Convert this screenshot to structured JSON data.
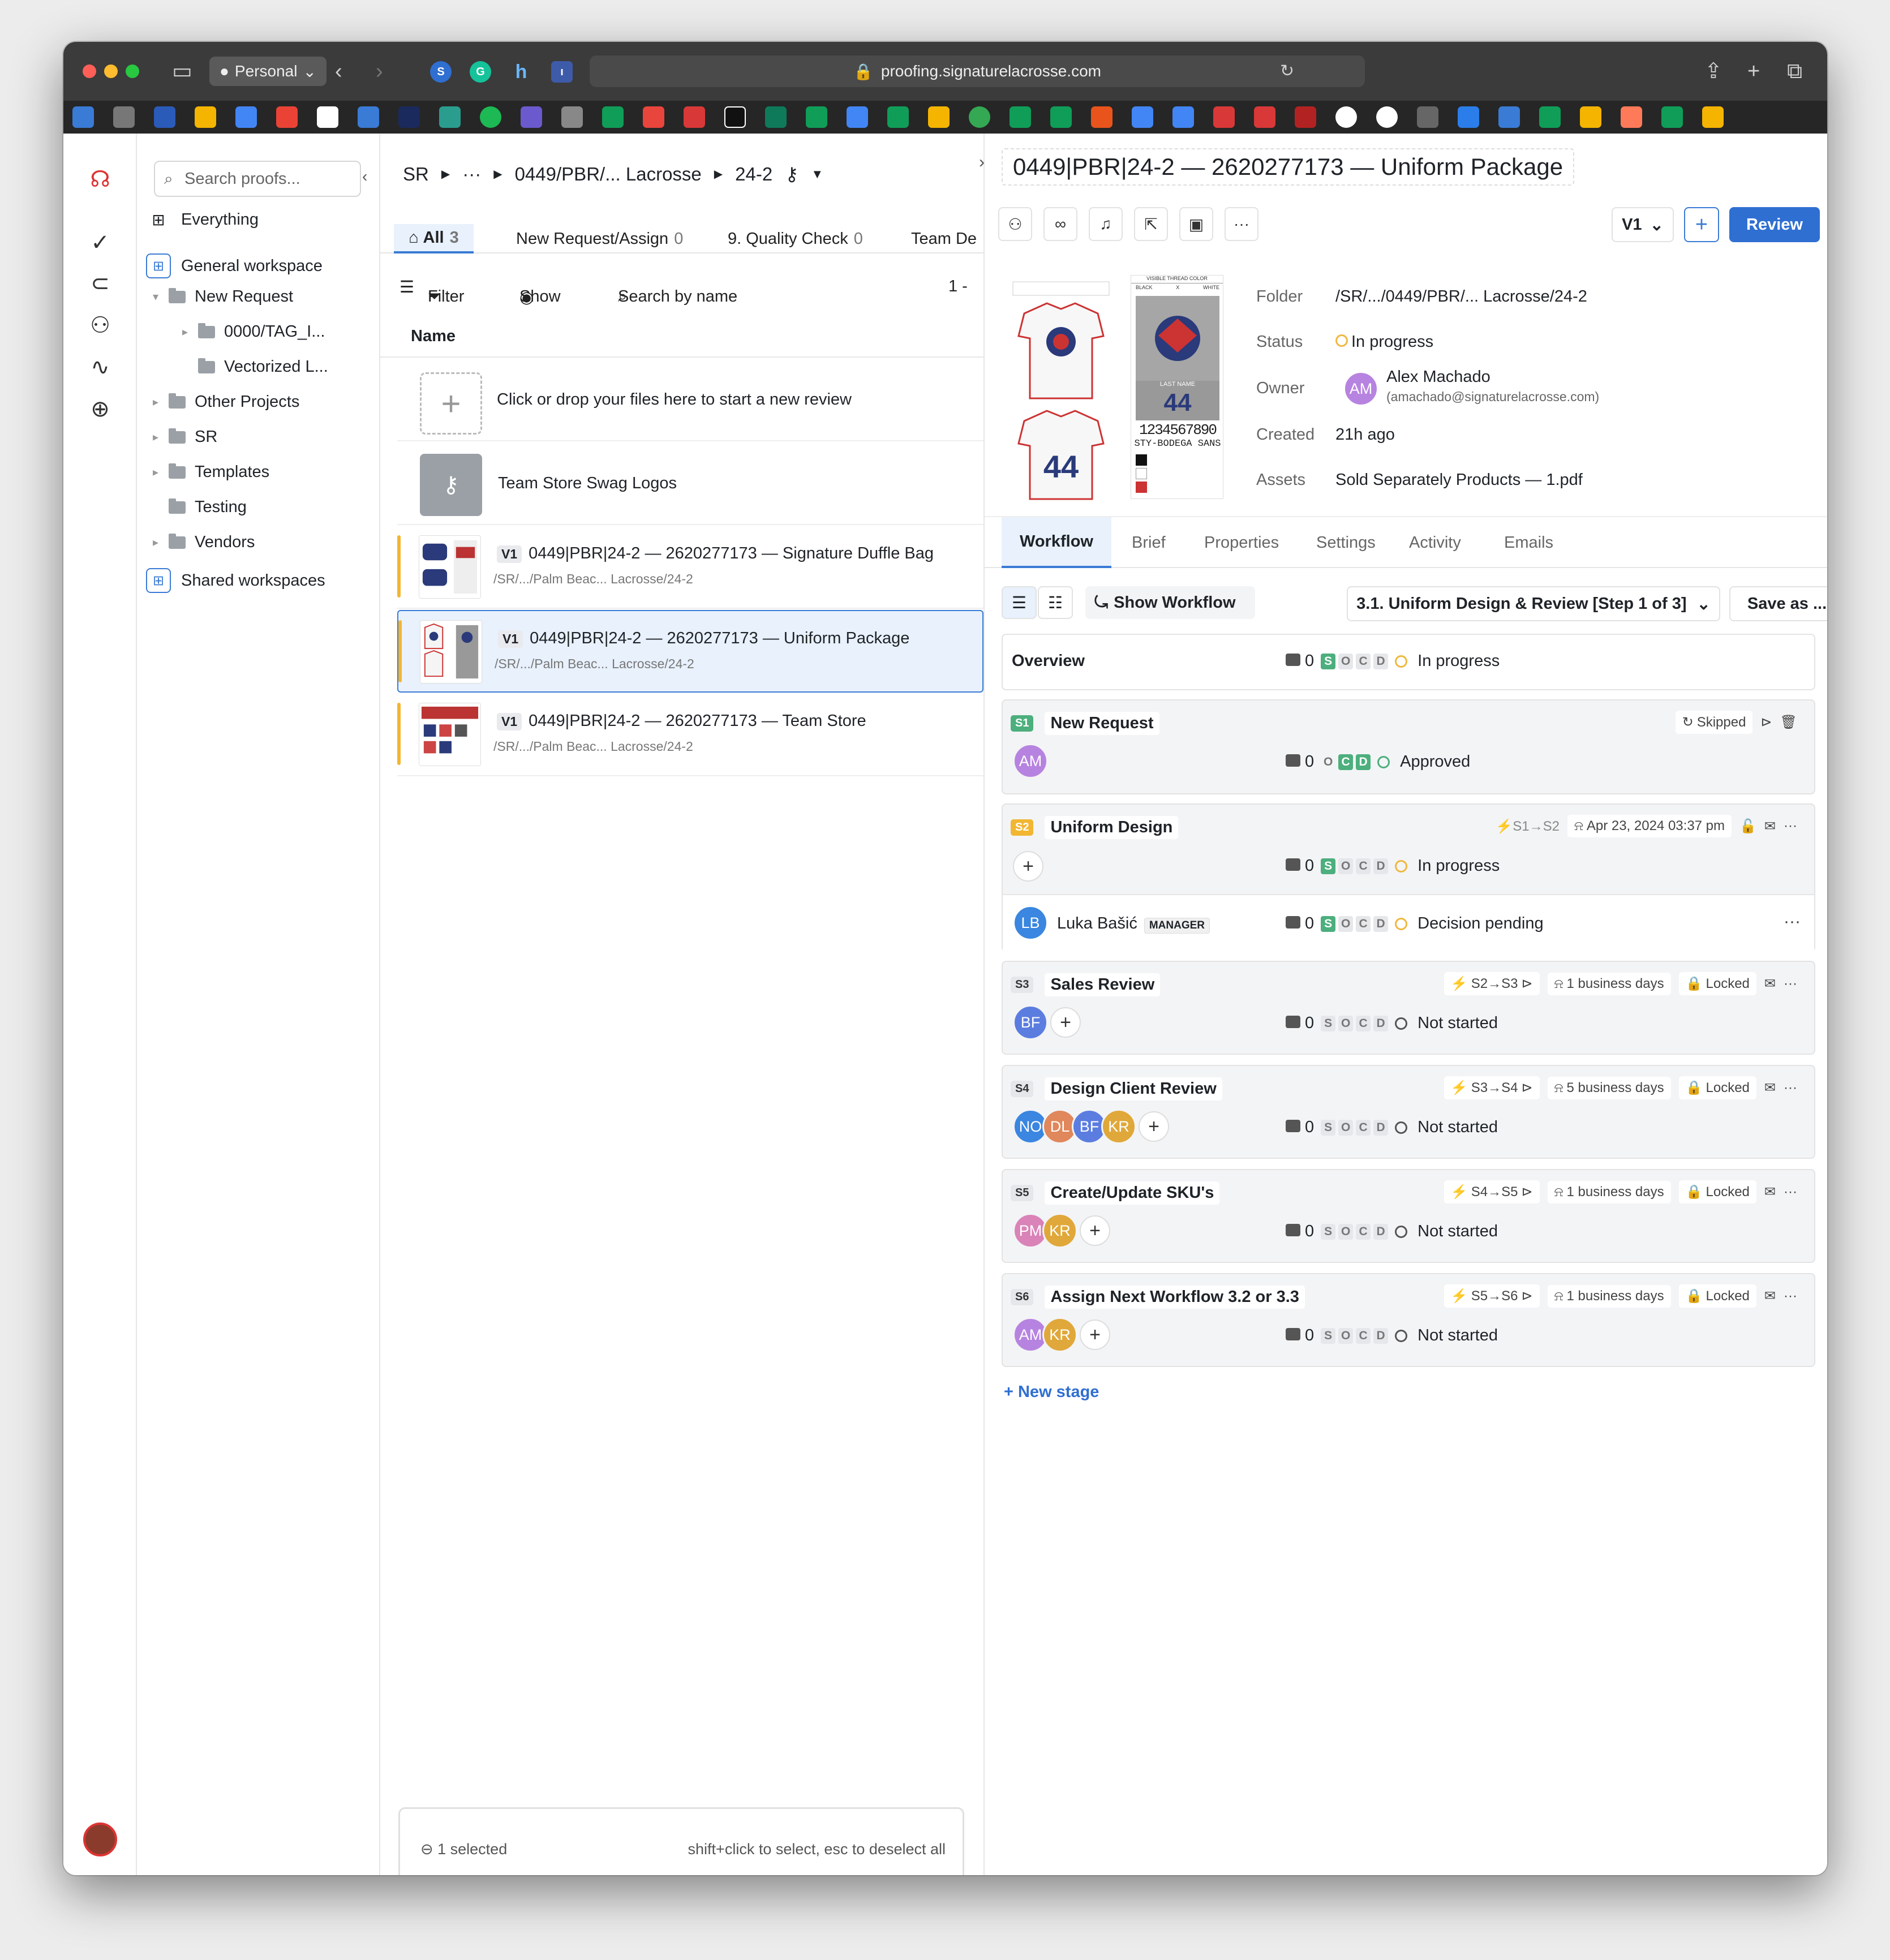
{
  "browser": {
    "profile": "Personal",
    "url": "proofing.signaturelacrosse.com"
  },
  "sidebar": {
    "search_placeholder": "Search proofs...",
    "everything": "Everything",
    "general_workspace": "General workspace",
    "tree": [
      "New Request",
      "0000/TAG_I...",
      "Vectorized L...",
      "Other Projects",
      "SR",
      "Templates",
      "Testing",
      "Vendors"
    ],
    "shared_workspaces": "Shared workspaces"
  },
  "list": {
    "breadcrumb": [
      "SR",
      "···",
      "0449/PBR/... Lacrosse",
      "24-2"
    ],
    "tabs": [
      {
        "label": "All",
        "count": "3"
      },
      {
        "label": "New Request/Assign",
        "count": "0"
      },
      {
        "label": "9. Quality Check",
        "count": "0"
      },
      {
        "label": "Team De",
        "count": ""
      }
    ],
    "toolbar": {
      "filter": "Filter",
      "show": "Show",
      "search": "Search by name",
      "range": "1 -"
    },
    "column_name": "Name",
    "drop_text": "Click or drop your files here to start a new review",
    "folder_row": "Team Store Swag Logos",
    "rows": [
      {
        "version": "V1",
        "title": "0449|PBR|24-2 — 2620277173 — Signature Duffle Bag",
        "path": "/SR/.../Palm Beac... Lacrosse/24-2"
      },
      {
        "version": "V1",
        "title": "0449|PBR|24-2 — 2620277173 — Uniform Package",
        "path": "/SR/.../Palm Beac... Lacrosse/24-2"
      },
      {
        "version": "V1",
        "title": "0449|PBR|24-2 — 2620277173 — Team Store",
        "path": "/SR/.../Palm Beac... Lacrosse/24-2"
      }
    ],
    "selection": {
      "count": "1 selected",
      "hint": "shift+click to select, esc to deselect all"
    }
  },
  "detail": {
    "title": "0449|PBR|24-2 — 2620277173 — Uniform Package",
    "version": "V1",
    "review_button": "Review",
    "meta": {
      "folder_label": "Folder",
      "folder": "/SR/.../0449/PBR/... Lacrosse/24-2",
      "status_label": "Status",
      "status": "In progress",
      "owner_label": "Owner",
      "owner_initials": "AM",
      "owner_name": "Alex Machado",
      "owner_email": "(amachado@signaturelacrosse.com)",
      "created_label": "Created",
      "created": "21h ago",
      "assets_label": "Assets",
      "assets": "Sold Separately Products — 1.pdf"
    },
    "thumb_text": {
      "lastname": "LAST NAME",
      "number": "44",
      "digits": "1234567890",
      "font": "STY-BODEGA SANS",
      "colors": "VISIBLE THREAD COLOR",
      "black": "BLACK",
      "x": "X",
      "white": "WHITE"
    },
    "tabs": [
      "Workflow",
      "Brief",
      "Properties",
      "Settings",
      "Activity",
      "Emails"
    ],
    "workflow_bar": {
      "show_workflow": "Show Workflow",
      "step": "3.1. Uniform Design & Review [Step 1 of 3]",
      "save_as": "Save as ..."
    },
    "overview": {
      "label": "Overview",
      "comments": "0",
      "status": "In progress"
    },
    "stages": [
      {
        "badge": "S1",
        "name": "New Request",
        "chip": "Skipped",
        "avatars": [
          "AM"
        ],
        "comments": "0",
        "status": "Approved"
      },
      {
        "badge": "S2",
        "name": "Uniform Design",
        "transition": "S1→S2",
        "deadline": "Apr 23, 2024 03:37 pm",
        "comments": "0",
        "status": "In progress",
        "member": {
          "initials": "LB",
          "name": "Luka Bašić",
          "role": "MANAGER",
          "comments": "0",
          "status": "Decision pending"
        }
      },
      {
        "badge": "S3",
        "name": "Sales Review",
        "transition": "S2→S3",
        "duration": "1 business days",
        "lock": "Locked",
        "avatars": [
          "BF"
        ],
        "comments": "0",
        "status": "Not started"
      },
      {
        "badge": "S4",
        "name": "Design Client Review",
        "transition": "S3→S4",
        "duration": "5 business days",
        "lock": "Locked",
        "avatars": [
          "NO",
          "DL",
          "BF",
          "KR"
        ],
        "comments": "0",
        "status": "Not started"
      },
      {
        "badge": "S5",
        "name": "Create/Update SKU's",
        "transition": "S4→S5",
        "duration": "1 business days",
        "lock": "Locked",
        "avatars": [
          "PM",
          "KR"
        ],
        "comments": "0",
        "status": "Not started"
      },
      {
        "badge": "S6",
        "name": "Assign Next Workflow 3.2 or 3.3",
        "transition": "S5→S6",
        "duration": "1 business days",
        "lock": "Locked",
        "avatars": [
          "AM",
          "KR"
        ],
        "comments": "0",
        "status": "Not started"
      }
    ],
    "new_stage": "+ New stage"
  },
  "socd_letters": [
    "S",
    "O",
    "C",
    "D"
  ],
  "colors": {
    "accent": "#3a7bd5",
    "green": "#4caf7d",
    "amber": "#f0b840"
  }
}
